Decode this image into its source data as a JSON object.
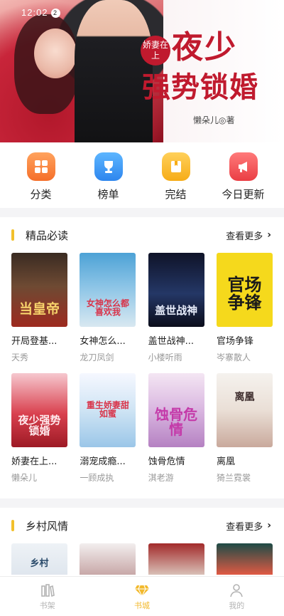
{
  "status_bar": {
    "time": "12:02",
    "badge": "2"
  },
  "banner": {
    "title_small": "娇妻在上",
    "title_line1": "夜少",
    "title_line2": "强势锁婚",
    "author": "懒朵儿◎著"
  },
  "categories": [
    {
      "label": "分类",
      "icon": "grid-icon",
      "color": "#f57a32"
    },
    {
      "label": "榜单",
      "icon": "trophy-icon",
      "color": "#2e86ee"
    },
    {
      "label": "完结",
      "icon": "book-bookmark-icon",
      "color": "#f6ac17"
    },
    {
      "label": "今日更新",
      "icon": "megaphone-icon",
      "color": "#ea3e44"
    }
  ],
  "section1": {
    "title": "精品必读",
    "more": "查看更多",
    "books": [
      {
        "name": "开局登基...",
        "author": "天秀",
        "cover_text": "当皇帝"
      },
      {
        "name": "女神怎么...",
        "author": "龙刀凤剑",
        "cover_text": "女神怎么都喜欢我"
      },
      {
        "name": "盖世战神...",
        "author": "小楼听雨",
        "cover_text": "盖世战神"
      },
      {
        "name": "官场争锋",
        "author": "岑寨散人",
        "cover_text": "官场争锋"
      },
      {
        "name": "娇妻在上...",
        "author": "懒朵儿",
        "cover_text": "夜少强势锁婚"
      },
      {
        "name": "溺宠成瘾...",
        "author": "一顾成执",
        "cover_text": "重生娇妻甜如蜜"
      },
      {
        "name": "蚀骨危情",
        "author": "淇老游",
        "cover_text": "蚀骨危情"
      },
      {
        "name": "离凰",
        "author": "猗兰霓裳",
        "cover_text": "离凰"
      }
    ]
  },
  "section2": {
    "title": "乡村风情",
    "more": "查看更多",
    "covers": [
      {
        "cover_text": "乡村"
      },
      {
        "cover_text": ""
      },
      {
        "cover_text": ""
      },
      {
        "cover_text": ""
      }
    ]
  },
  "tabbar": [
    {
      "label": "书架",
      "icon": "bookshelf-icon",
      "active": false
    },
    {
      "label": "书城",
      "icon": "diamond-icon",
      "active": true
    },
    {
      "label": "我的",
      "icon": "user-icon",
      "active": false
    }
  ],
  "colors": {
    "accent": "#f2b92d",
    "title_red": "#c01a2e"
  }
}
